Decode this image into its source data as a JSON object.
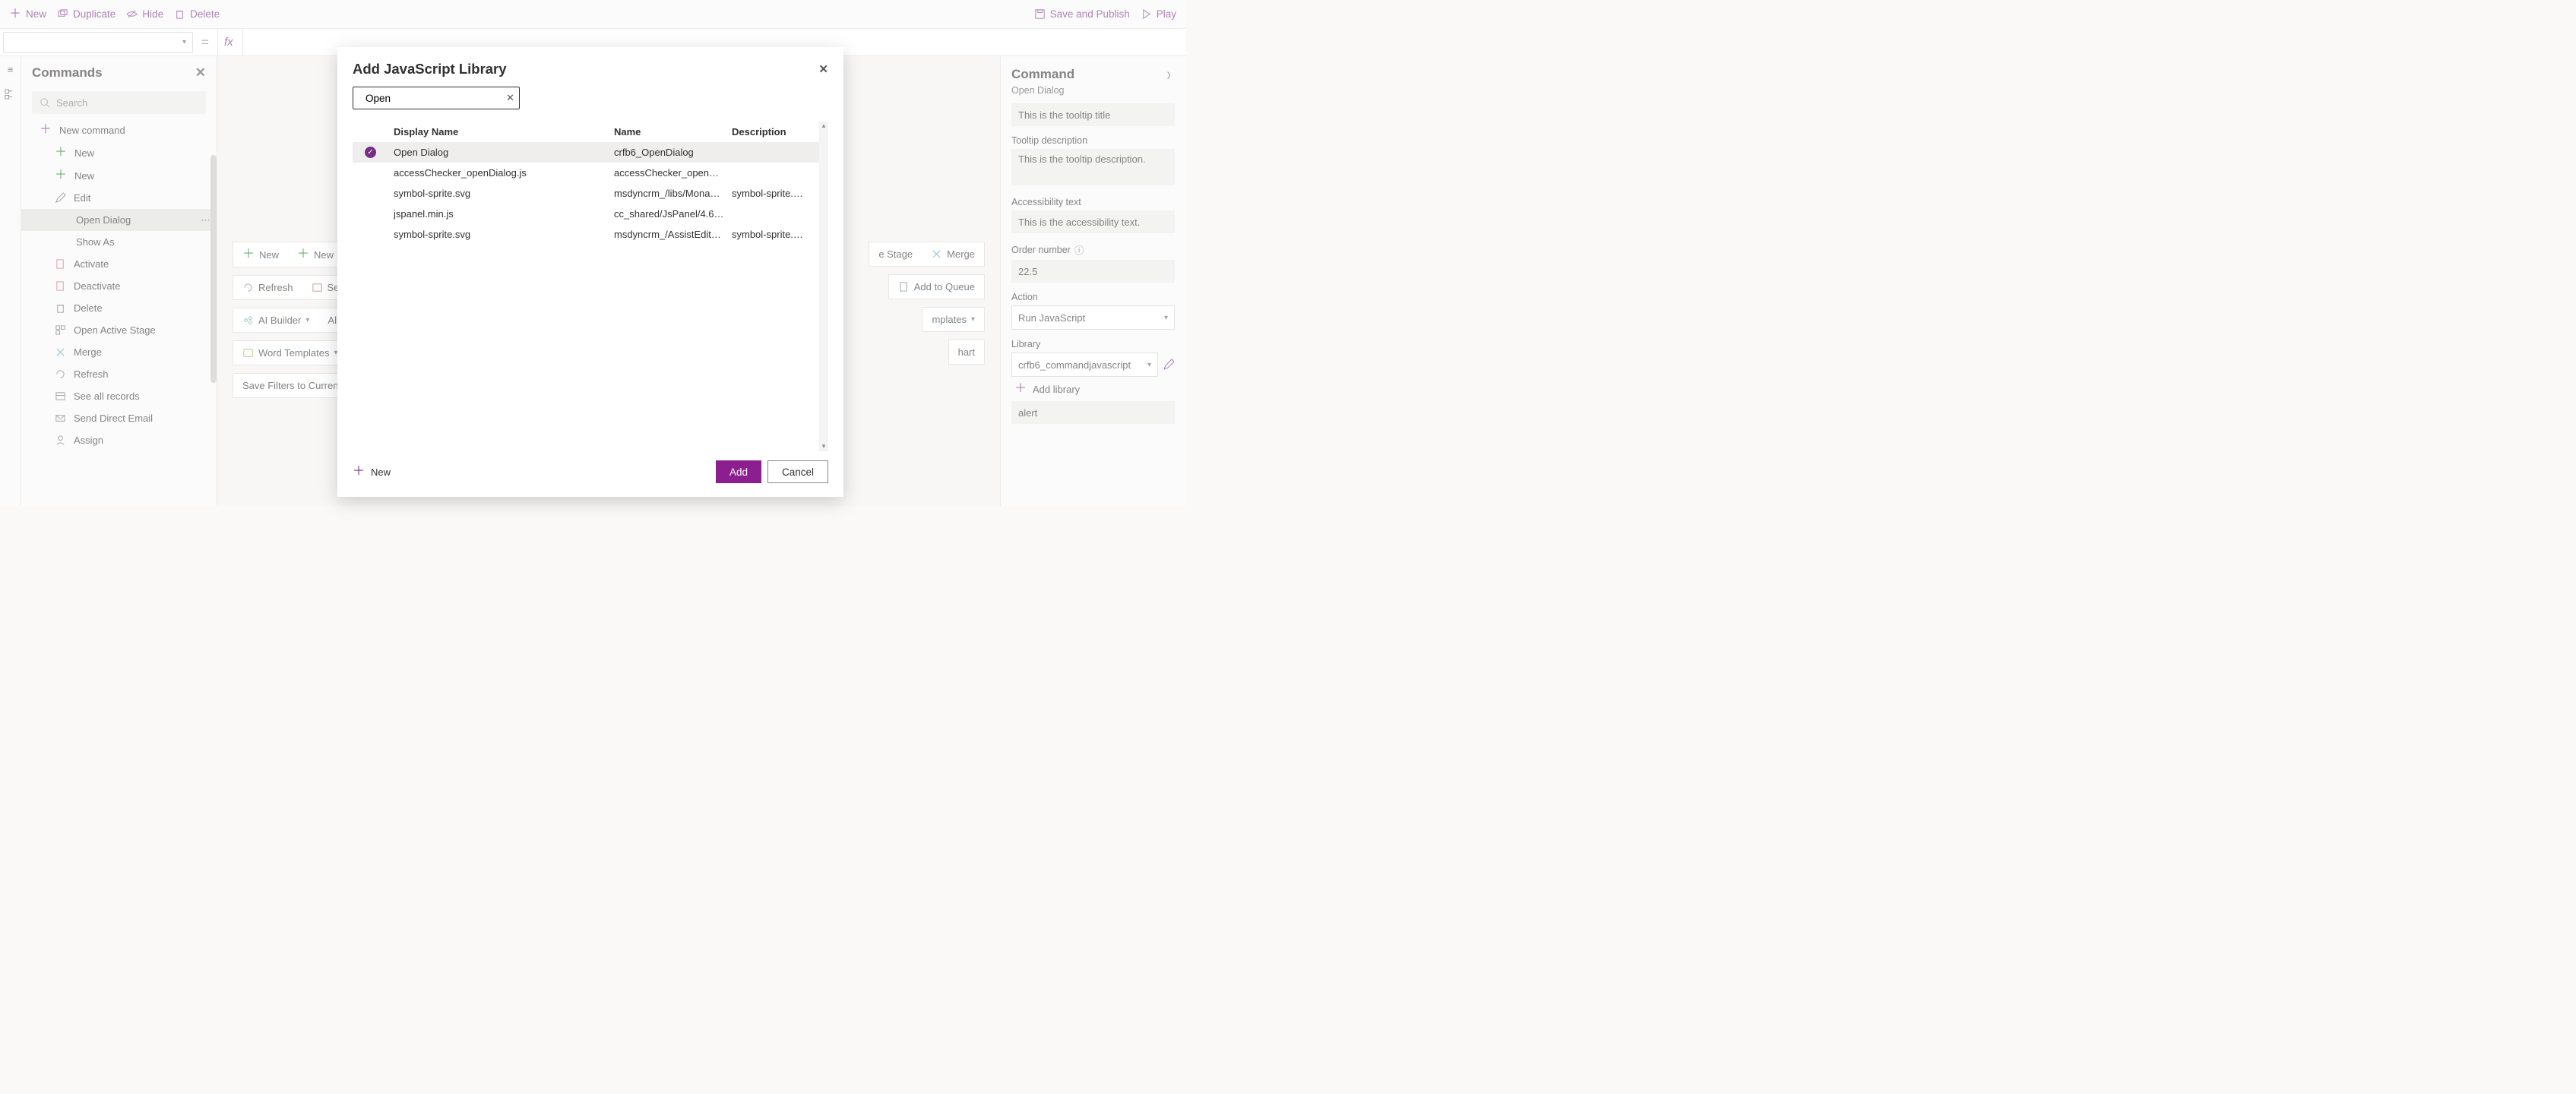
{
  "toolbar": {
    "new": "New",
    "duplicate": "Duplicate",
    "hide": "Hide",
    "delete": "Delete",
    "save_publish": "Save and Publish",
    "play": "Play"
  },
  "commands_panel": {
    "title": "Commands",
    "search_placeholder": "Search",
    "new_command": "New command",
    "items": [
      {
        "label": "New",
        "icon": "plus"
      },
      {
        "label": "New",
        "icon": "plus"
      },
      {
        "label": "Edit",
        "icon": "pencil"
      },
      {
        "label": "Open Dialog",
        "icon": "",
        "selected": true
      },
      {
        "label": "Show As",
        "icon": ""
      },
      {
        "label": "Activate",
        "icon": "doc"
      },
      {
        "label": "Deactivate",
        "icon": "doc-x"
      },
      {
        "label": "Delete",
        "icon": "trash"
      },
      {
        "label": "Open Active Stage",
        "icon": "grid"
      },
      {
        "label": "Merge",
        "icon": "merge"
      },
      {
        "label": "Refresh",
        "icon": "refresh"
      },
      {
        "label": "See all records",
        "icon": "records"
      },
      {
        "label": "Send Direct Email",
        "icon": "mail"
      },
      {
        "label": "Assign",
        "icon": "person"
      }
    ]
  },
  "canvas": {
    "row1": [
      "New",
      "New"
    ],
    "row1_right": [
      "e Stage",
      "Merge"
    ],
    "row2_left": [
      "Refresh",
      "Se"
    ],
    "row2_right": "Add to Queue",
    "row3_left": [
      "AI Builder",
      "All"
    ],
    "row3_right": "mplates",
    "row4_left": "Word Templates",
    "row4_right": "hart",
    "row5": "Save Filters to Current"
  },
  "props": {
    "title": "Command",
    "subtitle": "Open Dialog",
    "tooltip_title_value": "This is the tooltip title",
    "tooltip_desc_label": "Tooltip description",
    "tooltip_desc_value": "This is the tooltip description.",
    "access_label": "Accessibility text",
    "access_value": "This is the accessibility text.",
    "order_label": "Order number",
    "order_value": "22.5",
    "action_label": "Action",
    "action_value": "Run JavaScript",
    "library_label": "Library",
    "library_value": "crfb6_commandjavascript",
    "add_library": "Add library",
    "fn_value": "alert"
  },
  "modal": {
    "title": "Add JavaScript Library",
    "search_value": "Open",
    "columns": [
      "Display Name",
      "Name",
      "Description"
    ],
    "rows": [
      {
        "display": "Open Dialog",
        "name": "crfb6_OpenDialog",
        "desc": "",
        "selected": true
      },
      {
        "display": "accessChecker_openDialog.js",
        "name": "accessChecker_openDial…",
        "desc": ""
      },
      {
        "display": "symbol-sprite.svg",
        "name": "msdyncrm_/libs/Monaco…",
        "desc": "symbol-sprite.sv…"
      },
      {
        "display": "jspanel.min.js",
        "name": "cc_shared/JsPanel/4.6.0/…",
        "desc": ""
      },
      {
        "display": "symbol-sprite.svg",
        "name": "msdyncrm_/AssistEditCo…",
        "desc": "symbol-sprite.sv…"
      }
    ],
    "new": "New",
    "add": "Add",
    "cancel": "Cancel"
  }
}
